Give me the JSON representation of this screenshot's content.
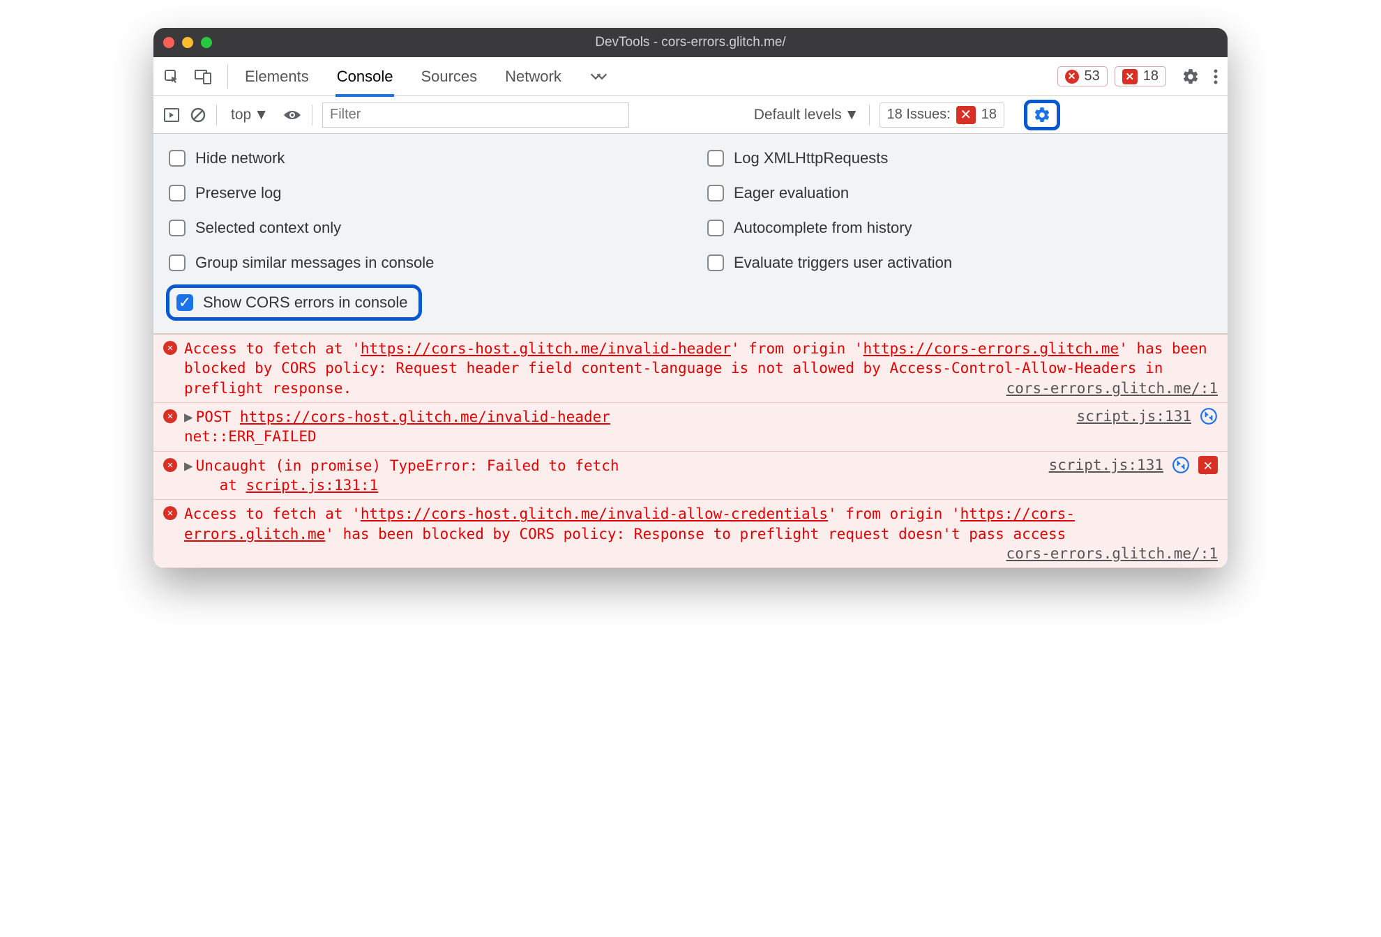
{
  "window": {
    "title": "DevTools - cors-errors.glitch.me/"
  },
  "tabs": {
    "items": [
      "Elements",
      "Console",
      "Sources",
      "Network"
    ],
    "active": "Console"
  },
  "badges": {
    "errors": "53",
    "issues": "18"
  },
  "toolbar": {
    "context": "top",
    "filter_placeholder": "Filter",
    "levels_label": "Default levels",
    "issues_label": "18 Issues:",
    "issues_count": "18"
  },
  "settings": {
    "left": [
      {
        "label": "Hide network",
        "checked": false
      },
      {
        "label": "Preserve log",
        "checked": false
      },
      {
        "label": "Selected context only",
        "checked": false
      },
      {
        "label": "Group similar messages in console",
        "checked": false
      },
      {
        "label": "Show CORS errors in console",
        "checked": true,
        "highlighted": true
      }
    ],
    "right": [
      {
        "label": "Log XMLHttpRequests",
        "checked": false
      },
      {
        "label": "Eager evaluation",
        "checked": false
      },
      {
        "label": "Autocomplete from history",
        "checked": false
      },
      {
        "label": "Evaluate triggers user activation",
        "checked": false
      }
    ]
  },
  "messages": [
    {
      "text_pre1": "Access to fetch at '",
      "url1": "https://cors-host.glitch.me/invalid-header",
      "text_mid1": "' from origin '",
      "url2": "https://cors-errors.glitch.me",
      "text_post1": "' has been blocked by CORS policy: Request header field content-language is not allowed by Access-Control-Allow-Headers in preflight response.",
      "source": "cors-errors.glitch.me/:1"
    },
    {
      "method": "POST",
      "url": "https://cors-host.glitch.me/invalid-header",
      "status": "net::ERR_FAILED",
      "source": "script.js:131",
      "has_net_icon": true
    },
    {
      "text": "Uncaught (in promise) TypeError: Failed to fetch",
      "stack_at": "at ",
      "stack_loc": "script.js:131:1",
      "source": "script.js:131",
      "has_net_icon": true,
      "has_issue_badge": true
    },
    {
      "text_pre1": "Access to fetch at '",
      "url1": "https://cors-host.glitch.me/invalid-allow-credentials",
      "text_mid1": "' from origin '",
      "url2": "https://cors-errors.glitch.me",
      "text_post1": "' has been blocked by CORS policy: Response to preflight request doesn't pass access",
      "source": "cors-errors.glitch.me/:1"
    }
  ]
}
